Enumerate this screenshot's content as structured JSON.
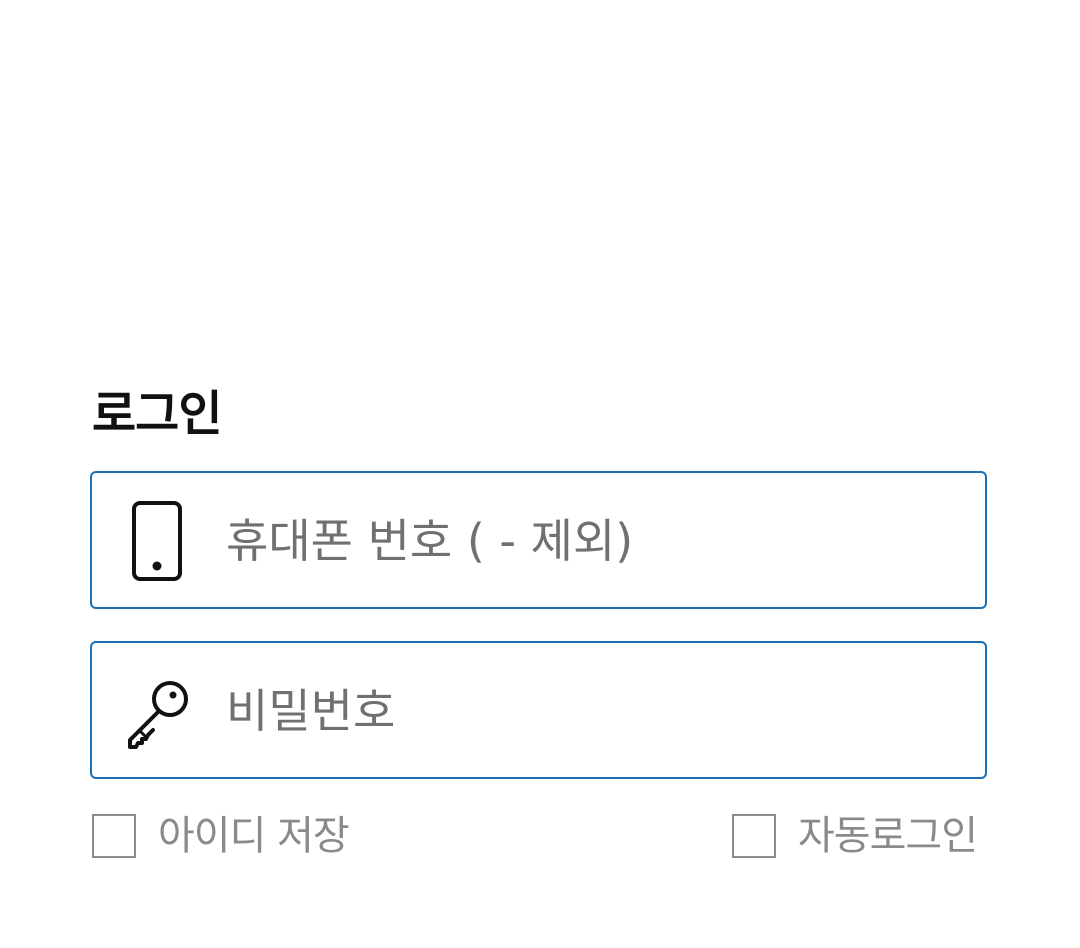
{
  "login": {
    "title": "로그인",
    "phone_field": {
      "icon": "smartphone-icon",
      "placeholder": "휴대폰 번호 ( - 제외)",
      "value": ""
    },
    "password_field": {
      "icon": "key-icon",
      "placeholder": "비밀번호",
      "value": ""
    },
    "save_id": {
      "label": "아이디 저장",
      "checked": false
    },
    "auto_login": {
      "label": "자동로그인",
      "checked": false
    }
  },
  "colors": {
    "field_border": "#1a6fb5",
    "placeholder": "#707070",
    "checkbox_border": "#8c8c8c",
    "checkbox_label": "#8a8a8a",
    "title": "#111111"
  }
}
